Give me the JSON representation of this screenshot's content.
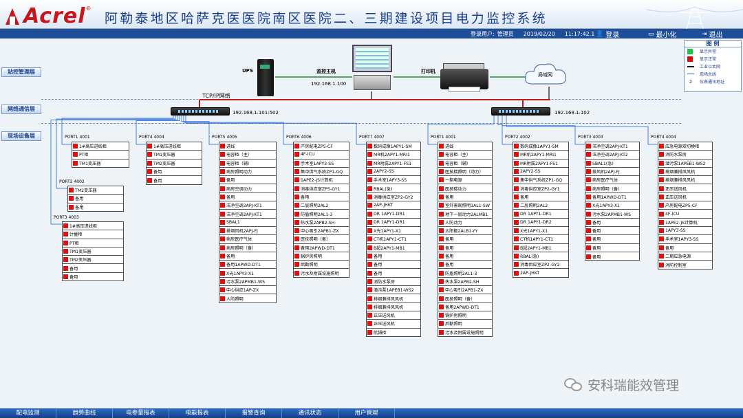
{
  "header": {
    "brand": "Acrel",
    "brand_reg": "®",
    "title": "阿勒泰地区哈萨克医医院南区医院二、三期建设项目电力监控系统"
  },
  "status": {
    "user_label": "登录用户:",
    "user": "管理员",
    "date": "2019/02/20",
    "time": "11:17:42.1",
    "login": "登录",
    "minimize": "最小化",
    "logout": "退出"
  },
  "levels": [
    "站控管理层",
    "网络通信层",
    "现场设备层"
  ],
  "legend": {
    "title": "图 例",
    "items": [
      {
        "type": "swatch",
        "color": "#19c24a",
        "label": "显示异常"
      },
      {
        "type": "swatch",
        "color": "#d11111",
        "label": "显示正常"
      },
      {
        "type": "line",
        "color": "#111111",
        "label": "工业以太网"
      },
      {
        "type": "line",
        "color": "#1c63d6",
        "label": "现场总线"
      },
      {
        "type": "num",
        "num": "2",
        "label": "仪表通讯地址"
      }
    ]
  },
  "devices": {
    "ups": "UPS",
    "host": "监控主机",
    "host_ip": "192.168.1.100",
    "printer": "打印机",
    "lan": "局域网",
    "tcp": "TCP/IP网络",
    "switch1_ip": "192.168.1.101:502",
    "switch2_ip": "192.168.1.102"
  },
  "ports": [
    {
      "title": "PORT1 4001",
      "items": [
        "1#高压进线柜",
        "PT柜",
        "TM1变压器"
      ]
    },
    {
      "title": "PORT2 4002",
      "items": [
        "TM2变压器",
        "备用",
        "备用"
      ]
    },
    {
      "title": "PORT3 4003",
      "items": [
        "1#高压进线柜",
        "计量柜",
        "PT柜",
        "TM1变压器",
        "TM2变压器",
        "备用",
        "备用"
      ]
    },
    {
      "title": "PORT4 4004",
      "items": [
        "1#高压进线柜",
        "TM1变压器",
        "TM2变压器",
        "备用",
        "备用"
      ]
    },
    {
      "title": "PORT5 4005",
      "items": [
        "进线",
        "电容柜（主）",
        "电容柜（辅）",
        "病房照明动力",
        "备用",
        "病房空调动力",
        "备用",
        "洁净空调2APJ-KT1",
        "洁净空调2APJ-KT1",
        "SBAL1",
        "排烟风机2APJ-FJ",
        "病房医疗气体",
        "病房照明（备）",
        "备用",
        "备用1APWD-DT1",
        "X光1APY3-X1",
        "污水泵2APMB1-WS",
        "中心供应1AP-ZX",
        "人防照明"
      ]
    },
    {
      "title": "PORT6 4006",
      "items": [
        "产房配电ZP5-CF",
        "4F-ICU",
        "手术室1APY3-SS",
        "集中供气系统ZP1-GQ",
        "1APE2-JS计算机",
        "消毒供应室ZP5-GY1",
        "备用",
        "二层照明2AL2",
        "防盾照明2AL1-3",
        "热水泵2APB2-SH",
        "中心吸引2APB1-ZX",
        "医技照明（备）",
        "备用2APWD-DT1",
        "锅炉房照明",
        "后勤照明",
        "污水及附属设施照明"
      ]
    },
    {
      "title": "PORT7 4007",
      "items": [
        "数码成像1APY1-SM",
        "MR机2APY1-MRI1",
        "MR附属2APY1-FS1",
        "2APY2-SS",
        "手术室1APY3-SS",
        "RBAL(急)",
        "消毒供应室ZP2-GY2",
        "2AP-JHKT",
        "DR 1APY1-DR1",
        "DR 1APY1-DR1",
        "X光1APY1-X1",
        "CT机1APY1-CT1",
        "B超2APY1-MB1",
        "备用",
        "备用",
        "备用",
        "消防水泵房",
        "潜污泵1APEB1-WS2",
        "排烟兼排风风机",
        "排烟兼排风风机",
        "正压送风机",
        "正压送风机",
        "航锅柜"
      ]
    },
    {
      "title": "PORT1 4001",
      "items": [
        "进线",
        "电容柜（主）",
        "电容柜（辅）",
        "医技楼照明（动力）",
        "一期电源",
        "医技楼动力",
        "备用",
        "室外景观照明1AL1-SW",
        "地下一层动力2ALMB1",
        "人防动力",
        "太阳能2ALB1-YY",
        "备用",
        "备用",
        "备用",
        "备用",
        "防盾照明2AL1-3",
        "热水泵2APB2-SH",
        "中心吸引2APB1-ZX",
        "医技照明（备）",
        "备用2APWD-DT1",
        "锅炉房照明",
        "后勤照明",
        "污水及附属设施照明"
      ]
    },
    {
      "title": "PORT2 4002",
      "items": [
        "数码成像1APY1-SM",
        "MR机2APY1-MRI1",
        "MR附属2APY1-FS1",
        "2APY2-SS",
        "集中供气系统ZP1-GQ",
        "消毒供应室ZP2-GY1",
        "备用",
        "二层照明2AL2",
        "DR 1APY1-DR1",
        "DR 1APY1-DR2",
        "X光1APY1-X1",
        "CT机1APY1-CT1",
        "B超2APY1-MB1",
        "RBAL(急)",
        "消毒供应室ZP2-GY2",
        "2AP-JHKT"
      ]
    },
    {
      "title": "PORT3 4003",
      "items": [
        "洁净空调2APJ-KT1",
        "洁净空调2APJ-KT2",
        "SBAL1(急)",
        "排风机2APJ-FJ",
        "病房医疗气体",
        "病房照明（备）",
        "备用1APWD-DT1",
        "X光1APY3-X1",
        "污水泵2APMB1-WS",
        "备用",
        "备用",
        "备用",
        "备用",
        "备用"
      ]
    },
    {
      "title": "PORT4 4004",
      "items": [
        "应急电源双切换柜",
        "消防水泵房",
        "潜污泵1APEB1-WS2",
        "排烟兼排风风机",
        "排烟兼排风风机",
        "正压送风机",
        "正压送风机",
        "产房配电ZP5-CF",
        "4F-ICU",
        "1APE2-JS计算机",
        "1APY3-SS",
        "手术室1APY3-SS",
        "备用",
        "二期应急电源",
        "消防控制室"
      ]
    }
  ],
  "watermark": "安科瑞能效管理",
  "tabs": [
    "配电监测",
    "趋势曲线",
    "电参量报表",
    "电能报表",
    "报警查询",
    "通讯状态",
    "用户管理"
  ]
}
